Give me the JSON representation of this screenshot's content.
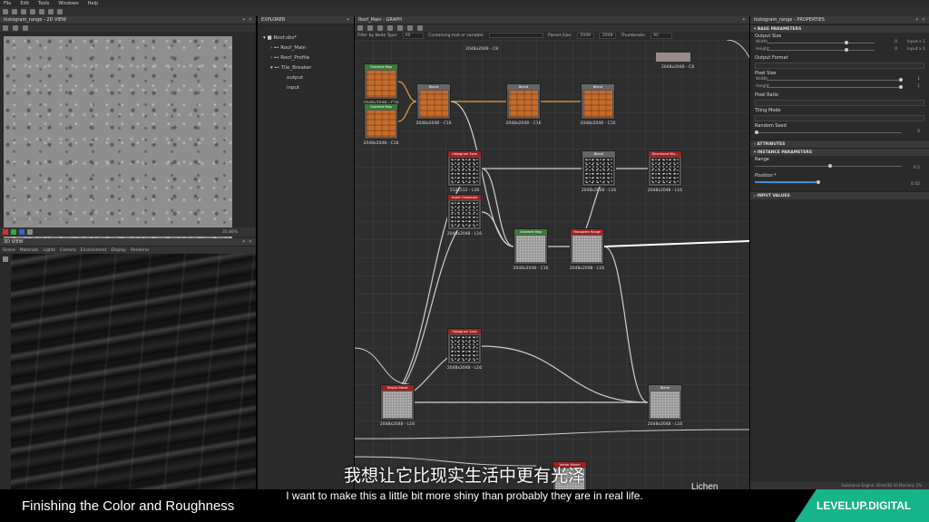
{
  "menu": [
    "File",
    "Edit",
    "Tools",
    "Windows",
    "Help"
  ],
  "view2d": {
    "title": "histogram_range - 2D VIEW",
    "info": "2048 x 2048 (Grayscale, 16bpc)",
    "zoom": "35.88%"
  },
  "view3d": {
    "title": "3D VIEW",
    "menus": [
      "Scene",
      "Materials",
      "Lights",
      "Camera",
      "Environment",
      "Display",
      "Renderer"
    ]
  },
  "explorer": {
    "title": "EXPLORER",
    "root": "Roof.sbs*",
    "items": [
      "Roof_Main",
      "Roof_Profile",
      "Tile_Breaker"
    ],
    "children": [
      "output",
      "input"
    ]
  },
  "graph": {
    "title": "Roof_Main - GRAPH",
    "filter_label": "Filter by Node Type:",
    "filter_value": "All",
    "contain_label": "Containing text or variable:",
    "parent_size_label": "Parent Size:",
    "parent_size": "2048",
    "size2": "2048",
    "thumbnails_label": "Thumbnails:",
    "thumbnails_value": "All",
    "nodes": [
      {
        "title": "Gradient Map",
        "label": "2048x2048 - C16",
        "kind": "orange",
        "tc": "#3a7a3a"
      },
      {
        "title": "Gradient Map",
        "label": "2048x2048 - C16",
        "kind": "orange",
        "tc": "#3a7a3a"
      },
      {
        "title": "Blend",
        "label": "2048x2048 - C16",
        "kind": "orange",
        "tc": "#666"
      },
      {
        "title": "Blend",
        "label": "2048x2048 - C16",
        "kind": "orange",
        "tc": "#666"
      },
      {
        "title": "Blend",
        "label": "2048x2048 - C16",
        "kind": "orange",
        "tc": "#666"
      },
      {
        "title": "Histogram Scan",
        "label": "512x512 - L16",
        "kind": "bw",
        "tc": "#a02020"
      },
      {
        "title": "Blend",
        "label": "2048x2048 - L16",
        "kind": "bw",
        "tc": "#666"
      },
      {
        "title": "Directional Blu...",
        "label": "2048x2048 - L16",
        "kind": "bw",
        "tc": "#a02020"
      },
      {
        "title": "Invert Grayscale",
        "label": "2048x2048 - L16",
        "kind": "bw",
        "tc": "#a02020"
      },
      {
        "title": "Gradient Map",
        "label": "2048x2048 - C16",
        "kind": "gr",
        "tc": "#3a7a3a"
      },
      {
        "title": "Histogram Range",
        "label": "2048x2048 - L16",
        "kind": "gr",
        "tc": "#a02020"
      },
      {
        "title": "Histogram Scan",
        "label": "2048x2048 - L16",
        "kind": "bw",
        "tc": "#a02020"
      },
      {
        "title": "Height Blend",
        "label": "2048x2048 - L16",
        "kind": "gr",
        "tc": "#a02020"
      },
      {
        "title": "Blend",
        "label": "2048x2048 - L16",
        "kind": "gr",
        "tc": "#666"
      },
      {
        "title": "Vector Morph",
        "label": "",
        "kind": "gr",
        "tc": "#a02020"
      }
    ],
    "top_labels": [
      "2048x2048 - C8",
      "2048x2048 - C8"
    ],
    "corner_label": "Lichen"
  },
  "properties": {
    "title": "histogram_range - PROPERTIES",
    "base": "BASE PARAMETERS",
    "output_size": "Output Size",
    "width_label": "Width",
    "width_val": "0",
    "width_rel": "Input x 1",
    "height_label": "Height",
    "height_val": "0",
    "height_rel": "Input x 1",
    "output_format": "Output Format",
    "pixel_size": "Pixel Size",
    "ps_width": "1",
    "ps_height": "1",
    "pixel_ratio": "Pixel Ratio",
    "tiling": "Tiling Mode",
    "seed": "Random Seed",
    "seed_val": "0",
    "attributes": "ATTRIBUTES",
    "instance": "INSTANCE PARAMETERS",
    "range": "Range",
    "range_val": "0.5",
    "position": "Position *",
    "position_val": "0.42",
    "input_values": "INPUT VALUES",
    "status": "Substance Engine: Direct3D 10   Memory: 2%"
  },
  "subtitle_cn": "我想让它比现实生活中更有光泽",
  "subtitle_en": "I want to make this a little bit more shiny than probably they are in real life.",
  "lower_title": "Finishing the Color and Roughness",
  "brand": "LEVELUP.DIGITAL"
}
